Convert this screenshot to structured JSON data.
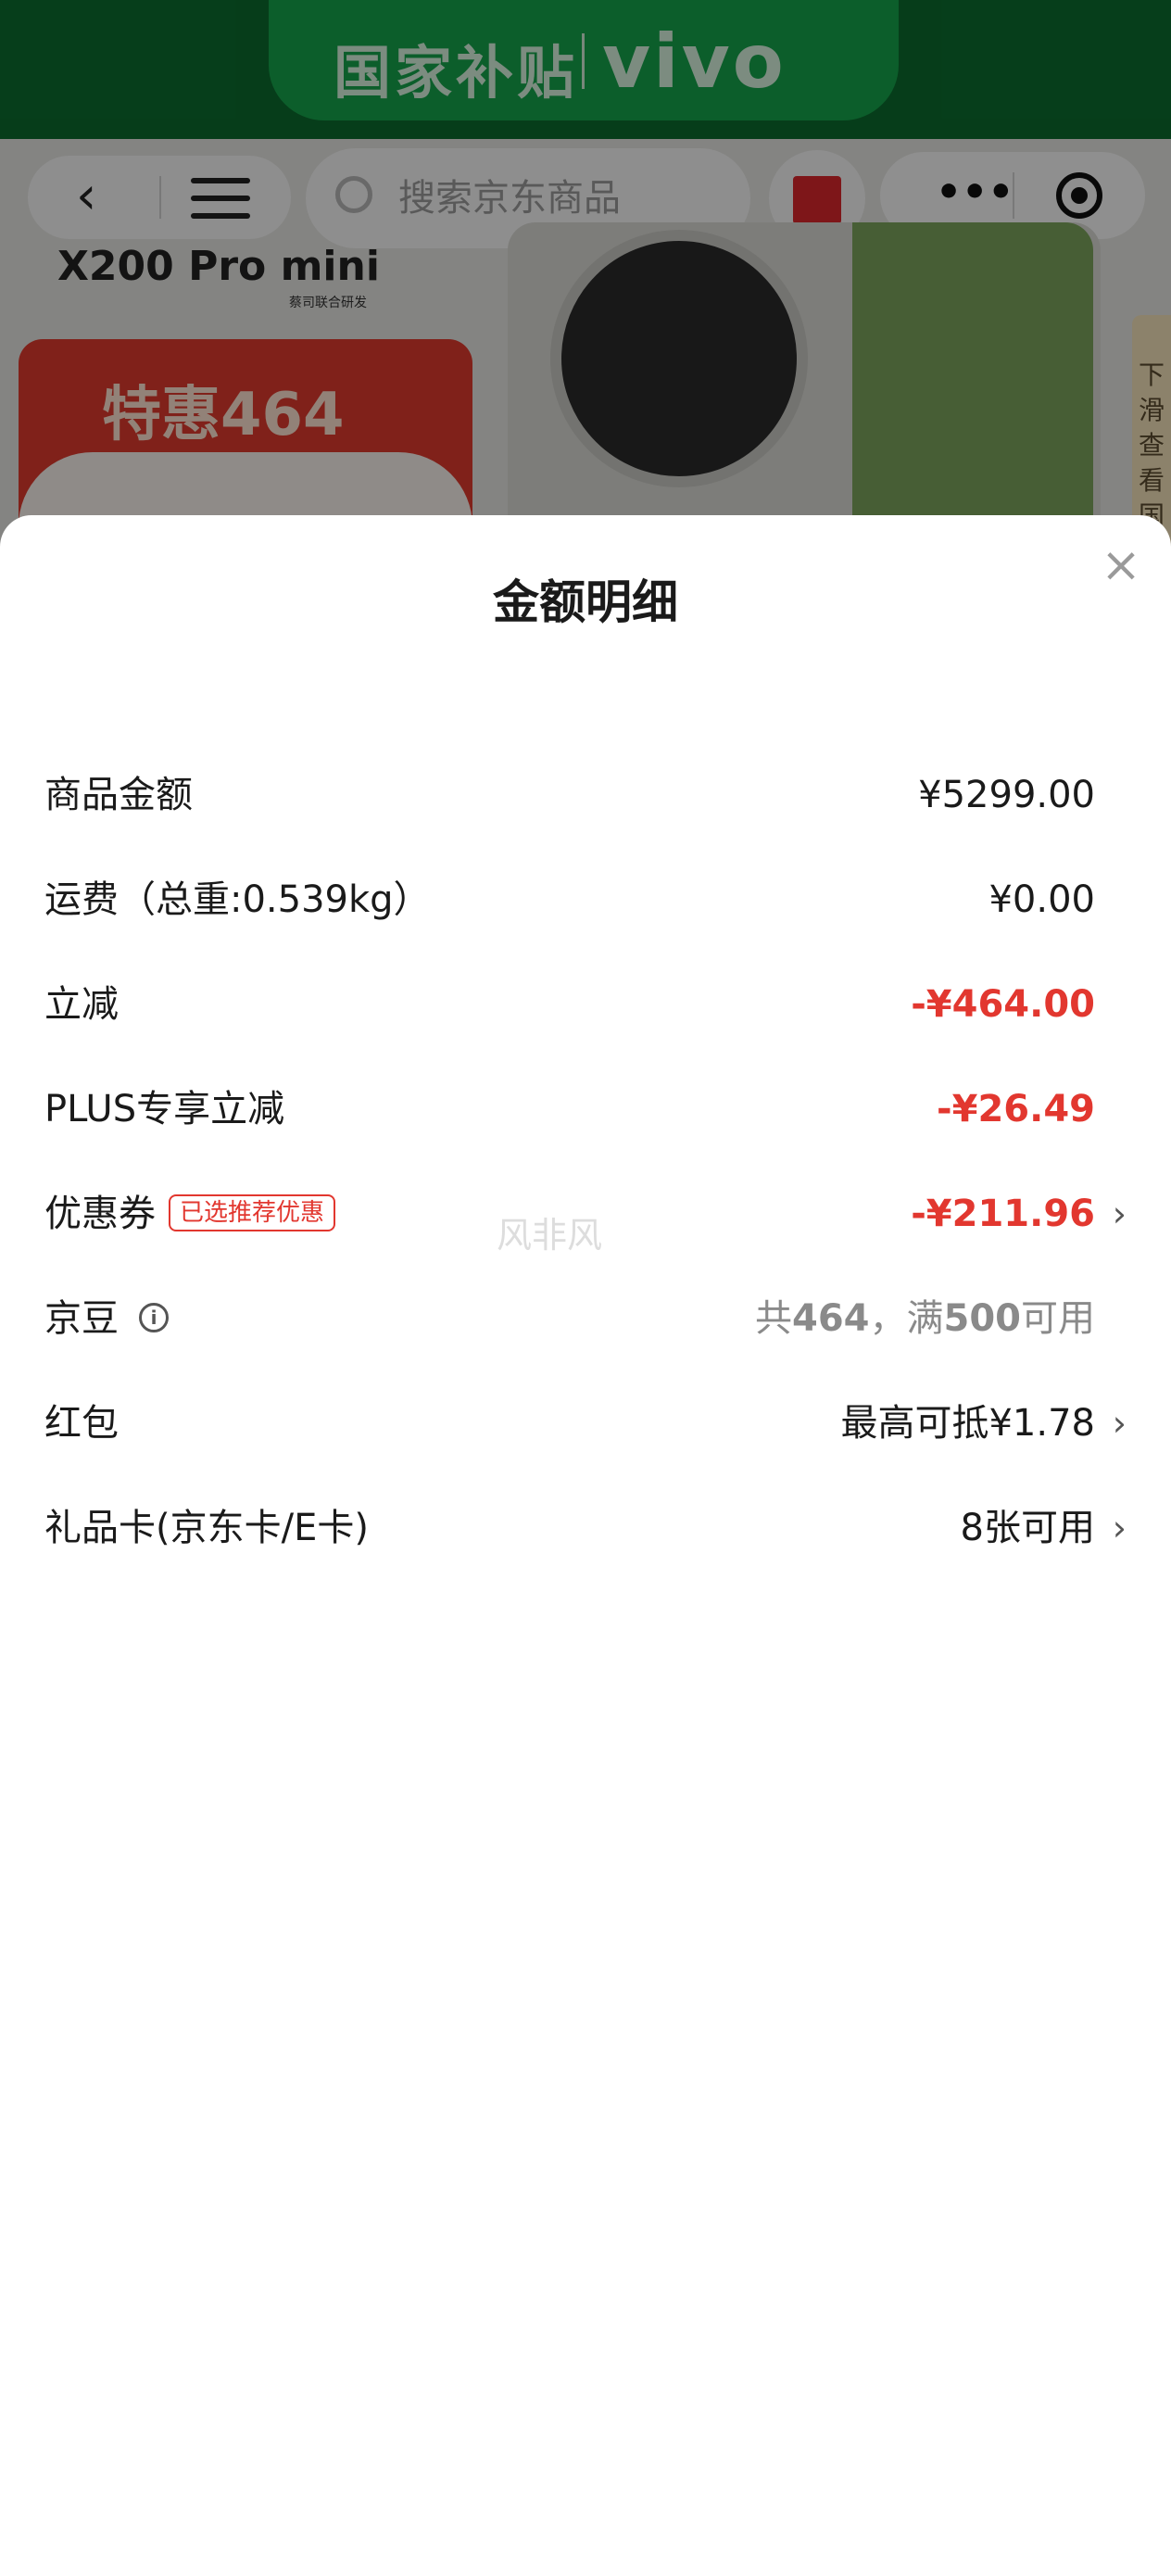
{
  "background": {
    "banner_text": "国家补贴",
    "brand": "vivo",
    "search_placeholder": "搜索京东商品",
    "model_name": "X200 Pro mini",
    "model_sub": "蔡司联合研发",
    "promo_text": "特惠464",
    "side_tab_text": "下滑查看国",
    "icons": {
      "back": "back-arrow-icon",
      "menu": "menu-icon",
      "search": "search-icon",
      "gift": "gift-icon",
      "more": "more-dots-icon",
      "target": "target-icon"
    }
  },
  "sheet": {
    "title": "金额明细",
    "close_glyph": "×",
    "rows": [
      {
        "label": "商品金额",
        "value": "¥5299.00"
      },
      {
        "label": "运费（总重:0.539kg）",
        "value": "¥0.00"
      },
      {
        "label": "立减",
        "value": "-¥464.00"
      },
      {
        "label": "PLUS专享立减",
        "value": "-¥26.49"
      },
      {
        "label": "优惠券",
        "tag": "已选推荐优惠",
        "value": "-¥211.96"
      },
      {
        "label": "京豆",
        "info_glyph": "i",
        "value_prefix": "共",
        "value_num1": "464",
        "value_mid": "，满",
        "value_num2": "500",
        "value_suffix": "可用"
      },
      {
        "label": "红包",
        "value": "最高可抵¥1.78"
      },
      {
        "label": "礼品卡(京东卡/E卡)",
        "value": "8张可用"
      }
    ],
    "chevron_glyph": "›",
    "watermark": "风非风",
    "colors": {
      "accent_red": "#e2372f",
      "muted_grey": "#8a8a8a"
    }
  }
}
